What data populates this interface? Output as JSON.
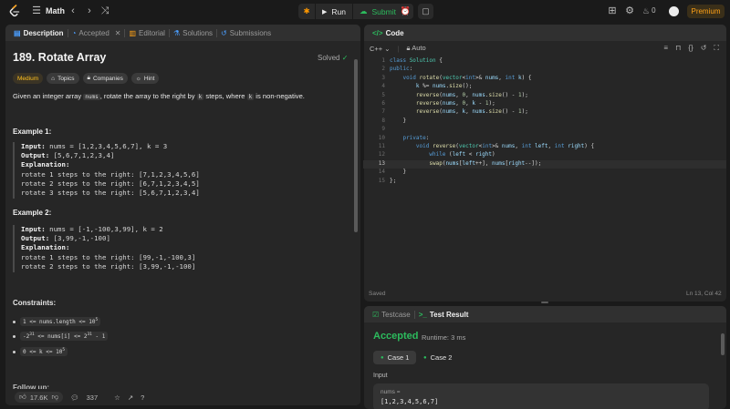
{
  "topbar": {
    "title": "Math",
    "run_label": "Run",
    "submit_label": "Submit",
    "streak_count": "0",
    "premium_label": "Premium"
  },
  "description_panel": {
    "tabs": [
      {
        "label": "Description"
      },
      {
        "label": "Accepted"
      },
      {
        "label": "Editorial"
      },
      {
        "label": "Solutions"
      },
      {
        "label": "Submissions"
      }
    ],
    "problem_title": "189. Rotate Array",
    "solved_label": "Solved",
    "tags": [
      "Medium",
      "Topics",
      "Companies",
      "Hint"
    ],
    "statement_before_nums": "Given an integer array ",
    "statement_code_nums": "nums",
    "statement_mid": ", rotate the array to the right by ",
    "statement_code_k": "k",
    "statement_mid2": " steps, where ",
    "statement_code_k2": "k",
    "statement_end": " is non-negative.",
    "example1": {
      "heading": "Example 1:",
      "input_label": "Input:",
      "input_value": " nums = [1,2,3,4,5,6,7], k = 3",
      "output_label": "Output:",
      "output_value": " [5,6,7,1,2,3,4]",
      "explanation_label": "Explanation:",
      "lines": [
        "rotate 1 steps to the right: [7,1,2,3,4,5,6]",
        "rotate 2 steps to the right: [6,7,1,2,3,4,5]",
        "rotate 3 steps to the right: [5,6,7,1,2,3,4]"
      ]
    },
    "example2": {
      "heading": "Example 2:",
      "input_label": "Input:",
      "input_value": " nums = [-1,-100,3,99], k = 2",
      "output_label": "Output:",
      "output_value": " [3,99,-1,-100]",
      "explanation_label": "Explanation:",
      "lines": [
        "rotate 1 steps to the right: [99,-1,-100,3]",
        "rotate 2 steps to the right: [3,99,-1,-100]"
      ]
    },
    "constraints_heading": "Constraints:",
    "constraints": [
      {
        "base": "1 <= nums.length <= 10",
        "sup": "5",
        "tail": ""
      },
      {
        "base": "-2",
        "sup": "31",
        "tail": " <= nums[i] <= 2",
        "sup2": "31",
        "tail2": " - 1"
      },
      {
        "base": "0 <= k <= 10",
        "sup": "5",
        "tail": ""
      }
    ],
    "follow_up": "Follow up:",
    "footer": {
      "likes": "17.6K",
      "comments": "337"
    }
  },
  "code_panel": {
    "tab_label": "Code",
    "language": "C++",
    "autocomplete": "Auto",
    "line_numbers": [
      "1",
      "2",
      "3",
      "4",
      "5",
      "6",
      "7",
      "8",
      "9",
      "10",
      "11",
      "12",
      "13",
      "14",
      "15"
    ],
    "saved_label": "Saved",
    "cursor_position": "Ln 13, Col 42"
  },
  "test_panel": {
    "tabs": [
      {
        "label": "Testcase"
      },
      {
        "label": "Test Result"
      }
    ],
    "status": "Accepted",
    "runtime": "Runtime: 3 ms",
    "cases": [
      "Case 1",
      "Case 2"
    ],
    "input_label": "Input",
    "input_key": "nums =",
    "input_value": "[1,2,3,4,5,6,7]"
  },
  "colors": {
    "accent_orange": "#ffa116",
    "success_green": "#2cbb5d",
    "medium_yellow": "#ffc01e",
    "panel_bg": "#262626",
    "page_bg": "#1a1a1a"
  }
}
